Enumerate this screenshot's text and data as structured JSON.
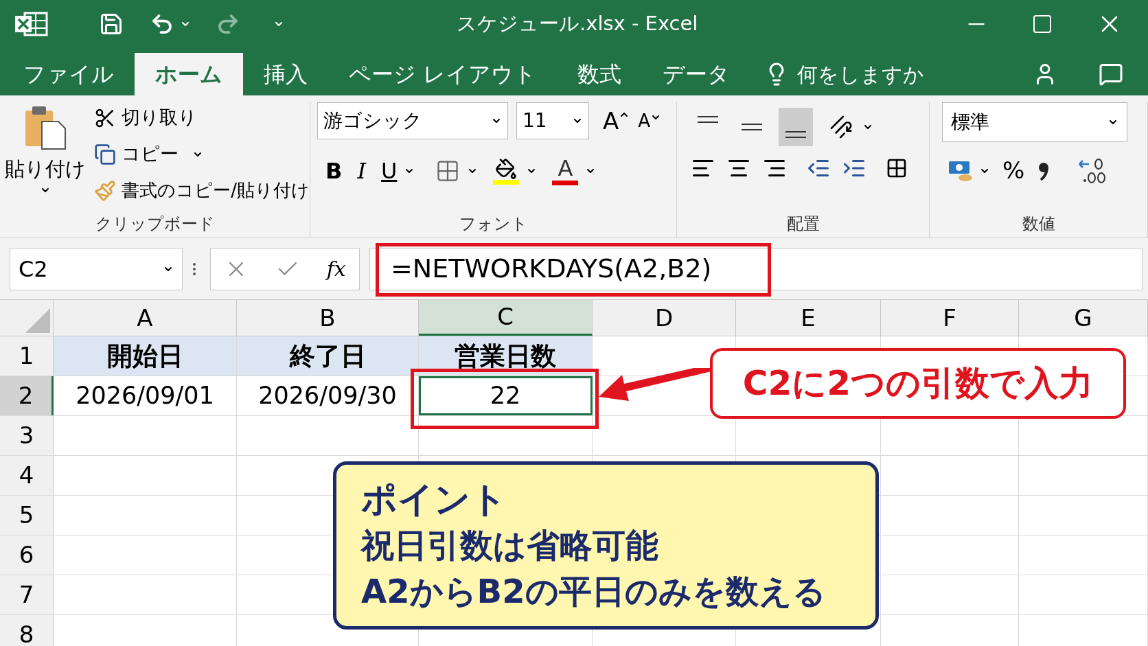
{
  "window": {
    "title": "スケジュール.xlsx - Excel"
  },
  "tabs": [
    {
      "label": "ファイル",
      "selected": false
    },
    {
      "label": "ホーム",
      "selected": true
    },
    {
      "label": "挿入",
      "selected": false
    },
    {
      "label": "ページ レイアウト",
      "selected": false
    },
    {
      "label": "数式",
      "selected": false
    },
    {
      "label": "データ",
      "selected": false
    }
  ],
  "tell_me": {
    "placeholder": "何をしますか"
  },
  "ribbon": {
    "clipboard": {
      "paste": "貼り付け",
      "cut": "切り取り",
      "copy": "コピー",
      "format_painter": "書式のコピー/貼り付け",
      "group_label": "クリップボード"
    },
    "font": {
      "name": "游ゴシック",
      "size": "11",
      "grow": "A",
      "shrink": "A",
      "bold": "B",
      "italic": "I",
      "underline": "U",
      "font_color_letter": "A",
      "group_label": "フォント"
    },
    "alignment": {
      "vertical": [
        {
          "selected": false
        },
        {
          "selected": false
        },
        {
          "selected": true
        }
      ],
      "group_label": "配置"
    },
    "number": {
      "format": "標準",
      "percent": "%",
      "group_label": "数値"
    }
  },
  "formula_bar": {
    "name_box": "C2",
    "fx": "fx",
    "formula": "=NETWORKDAYS(A2,B2)"
  },
  "sheet": {
    "columns": [
      {
        "label": "A",
        "selected": false
      },
      {
        "label": "B",
        "selected": false
      },
      {
        "label": "C",
        "selected": true
      },
      {
        "label": "D",
        "selected": false
      },
      {
        "label": "E",
        "selected": false
      },
      {
        "label": "F",
        "selected": false
      },
      {
        "label": "G",
        "selected": false
      }
    ],
    "rows": [
      {
        "label": "1",
        "selected": false,
        "kind": "header",
        "cells": [
          "開始日",
          "終了日",
          "営業日数"
        ]
      },
      {
        "label": "2",
        "selected": true,
        "kind": "data",
        "cells": [
          "2026/09/01",
          "2026/09/30",
          "22"
        ]
      },
      {
        "label": "3",
        "selected": false,
        "kind": "data"
      },
      {
        "label": "4",
        "selected": false,
        "kind": "data"
      },
      {
        "label": "5",
        "selected": false,
        "kind": "data"
      },
      {
        "label": "6",
        "selected": false,
        "kind": "data"
      },
      {
        "label": "7",
        "selected": false,
        "kind": "data"
      },
      {
        "label": "8",
        "selected": false,
        "kind": "data"
      }
    ]
  },
  "annotations": {
    "callout": "C2に2つの引数で入力",
    "point": {
      "title": "ポイント",
      "lines": [
        "祝日引数は省略可能",
        "A2からB2の平日のみを数える"
      ]
    }
  }
}
